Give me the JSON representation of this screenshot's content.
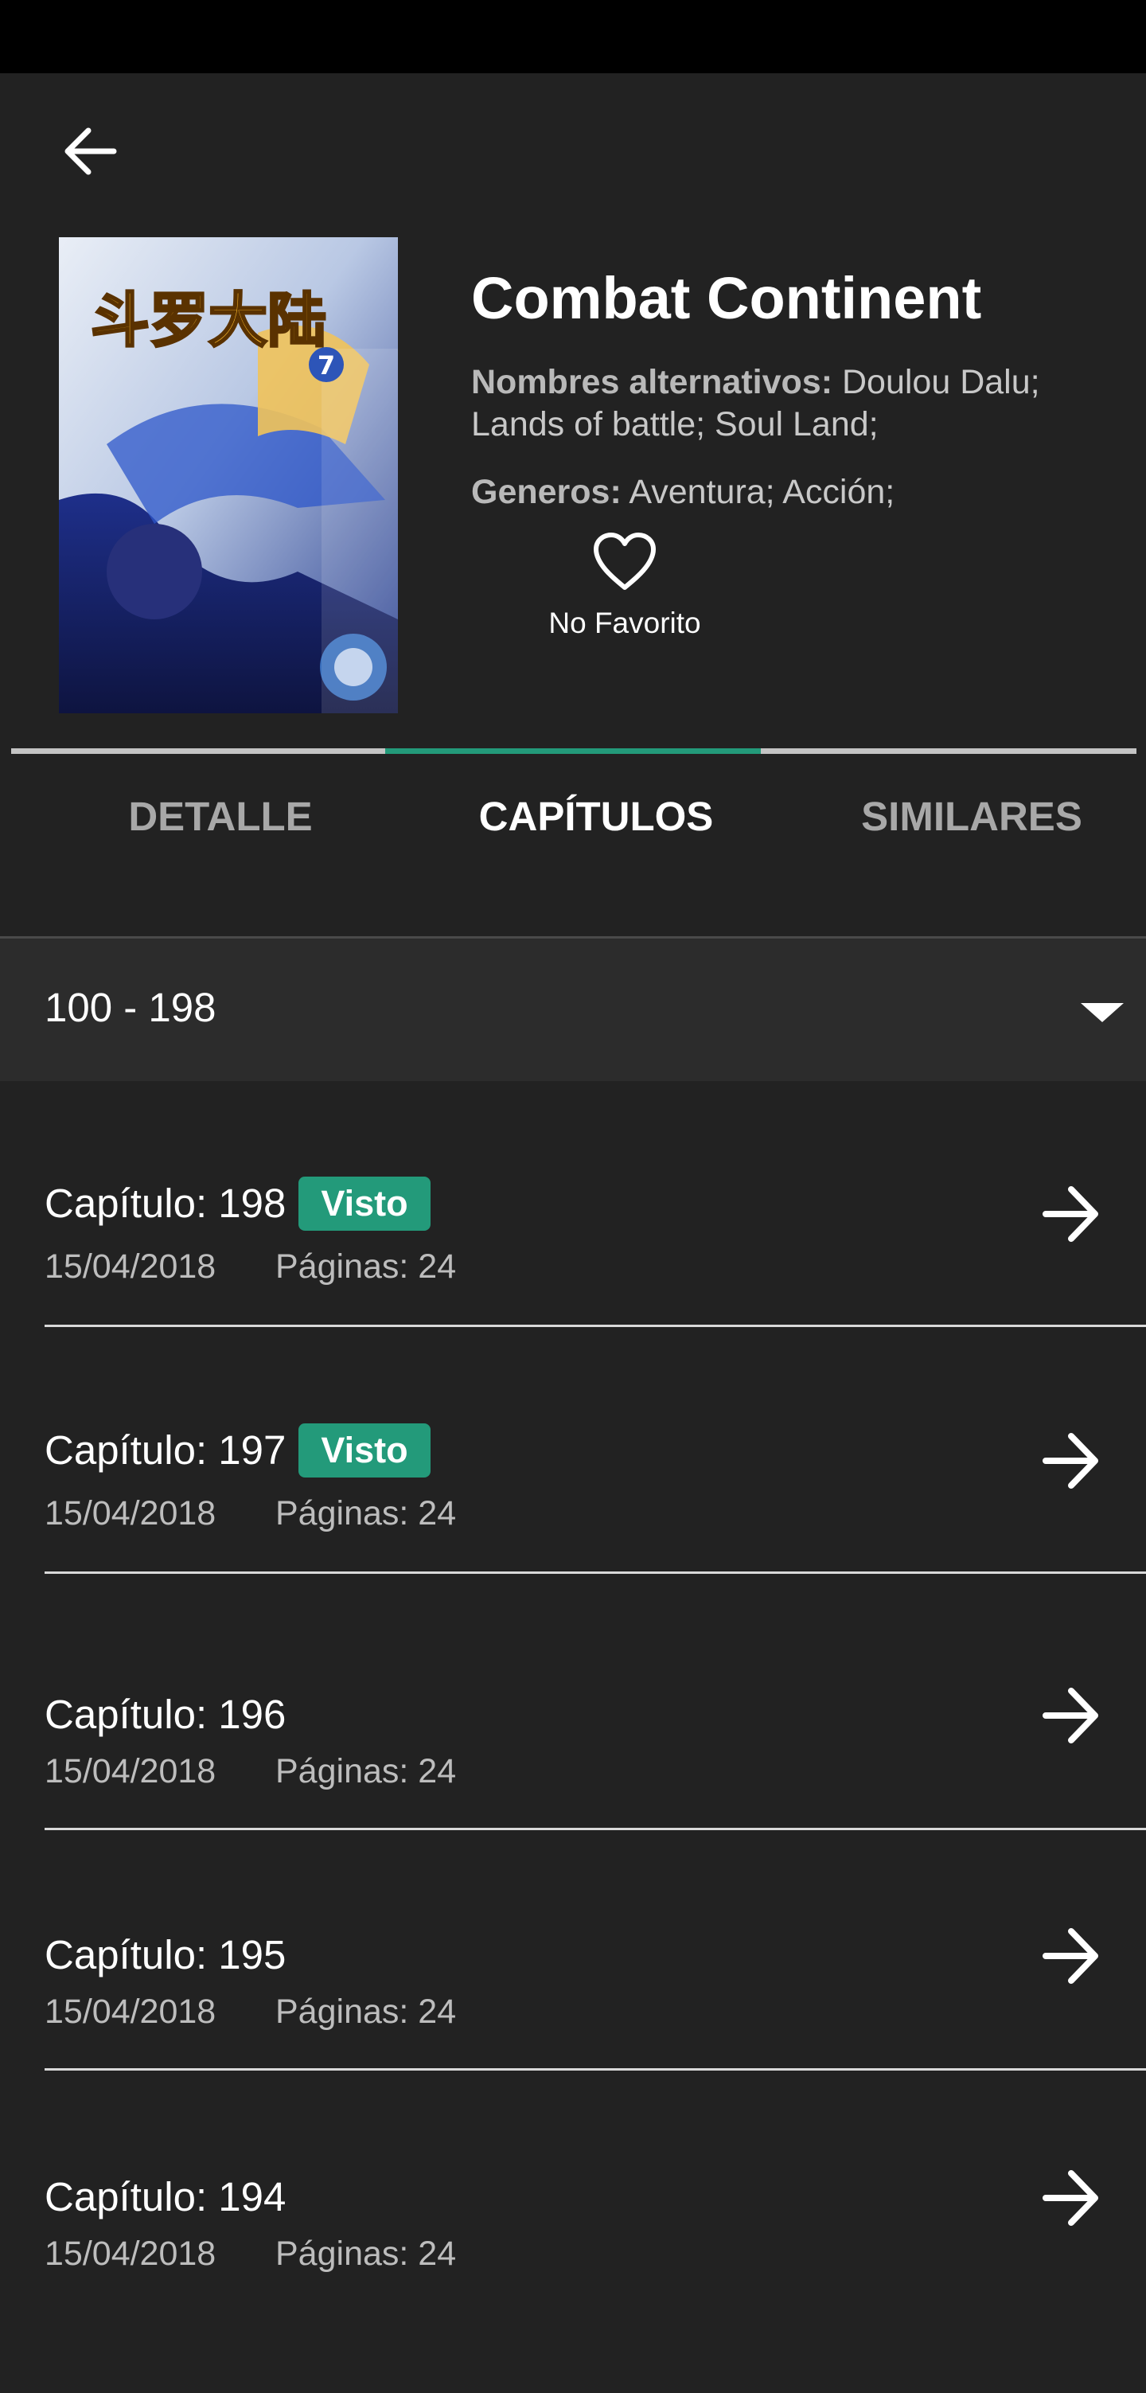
{
  "colors": {
    "accent": "#239a7a",
    "background": "#222222",
    "tab_inactive_line": "#c4c4c4"
  },
  "header": {
    "back_icon": "arrow-left-icon"
  },
  "manga": {
    "title": "Combat Continent",
    "alt_names_label": "Nombres alternativos:",
    "alt_names_value": " Doulou Dalu; Lands of battle; Soul Land;",
    "genres_label": "Generos:",
    "genres_value": " Aventura; Acción;",
    "cover_title_art": "斗罗大陆",
    "cover_volume": "7"
  },
  "favorite": {
    "icon": "heart-outline-icon",
    "label": "No Favorito"
  },
  "tabs": [
    {
      "label": "DETALLE",
      "active": false
    },
    {
      "label": "CAPÍTULOS",
      "active": true
    },
    {
      "label": "SIMILARES",
      "active": false
    }
  ],
  "range_selector": {
    "value": "100 - 198",
    "icon": "dropdown-triangle-icon"
  },
  "chapters": [
    {
      "title": "Capítulo: 198",
      "badge": "Visto",
      "date": "15/04/2018",
      "pages": "Páginas: 24"
    },
    {
      "title": "Capítulo: 197",
      "badge": "Visto",
      "date": "15/04/2018",
      "pages": "Páginas: 24"
    },
    {
      "title": "Capítulo: 196",
      "badge": "",
      "date": "15/04/2018",
      "pages": "Páginas: 24"
    },
    {
      "title": "Capítulo: 195",
      "badge": "",
      "date": "15/04/2018",
      "pages": "Páginas: 24"
    },
    {
      "title": "Capítulo: 194",
      "badge": "",
      "date": "15/04/2018",
      "pages": "Páginas: 24"
    }
  ]
}
